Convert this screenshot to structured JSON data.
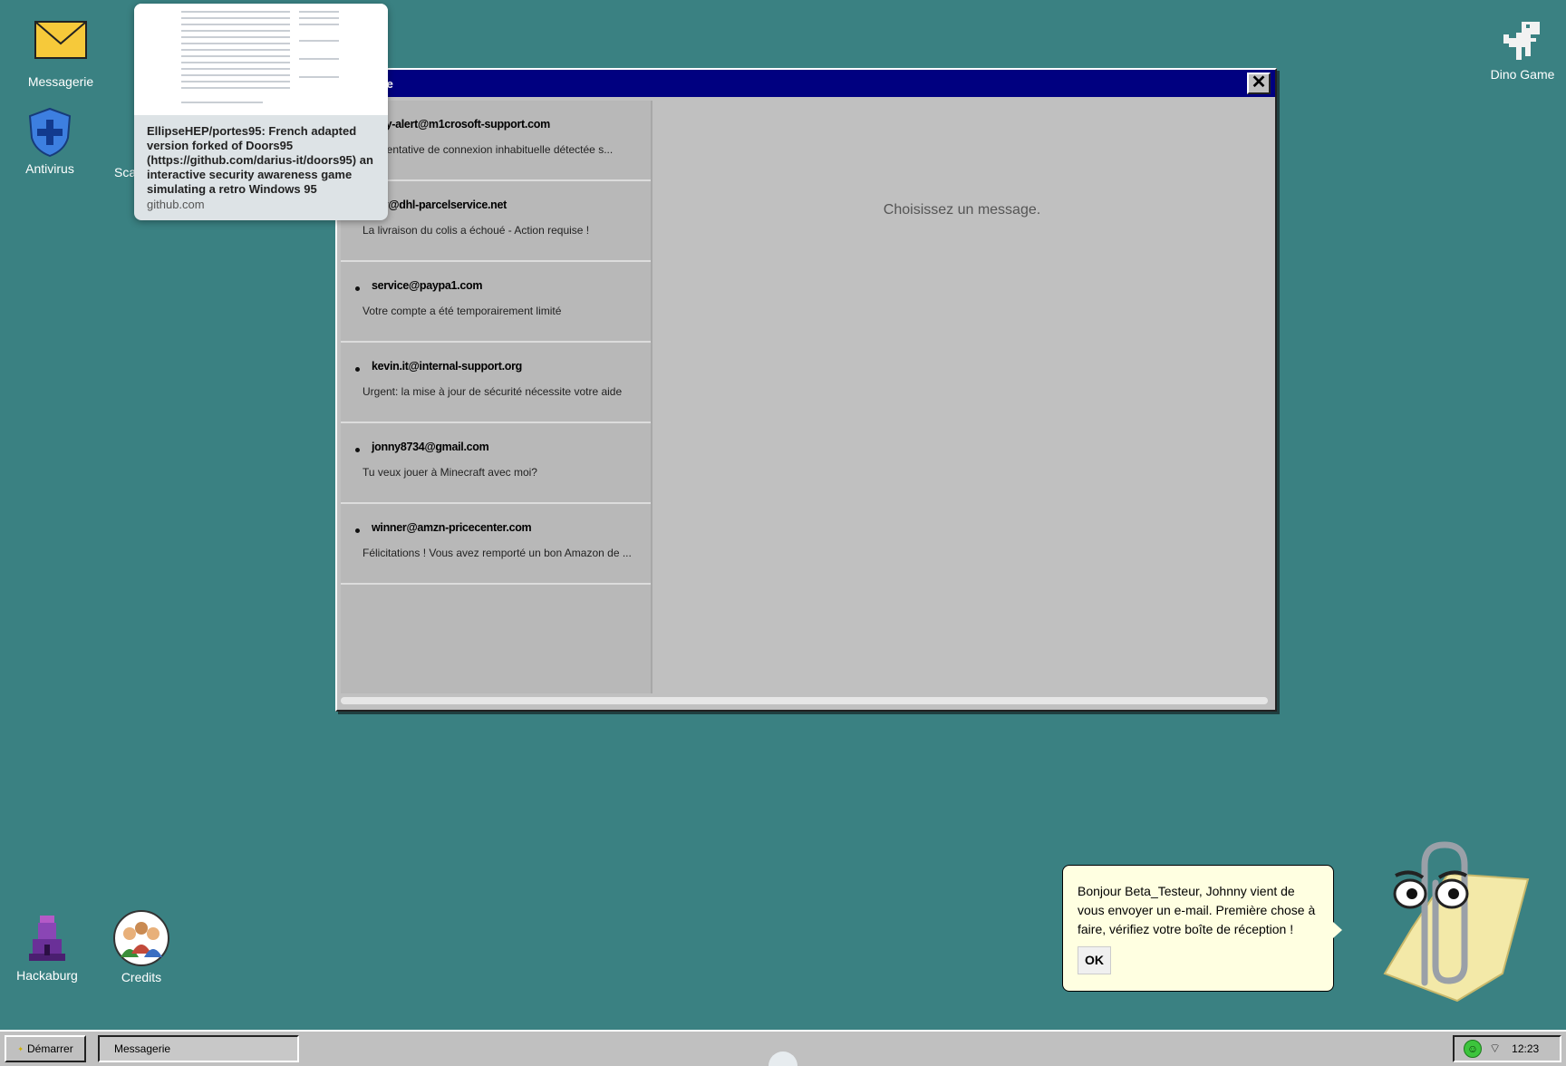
{
  "desktop": {
    "icons": {
      "messagerie": "Messagerie",
      "antivirus": "Antivirus",
      "scanner": "Sca",
      "hackaburg": "Hackaburg",
      "credits": "Credits",
      "dino": "Dino Game"
    }
  },
  "window": {
    "title": "rie",
    "close_glyph": "✕",
    "placeholder": "Choisissez un message.",
    "messages": [
      {
        "from": "curity-alert@m1crosoft-support.com",
        "subject": "ent: tentative de connexion inhabituelle détectée s...",
        "unread": false
      },
      {
        "from": "reply@dhl-parcelservice.net",
        "subject": "La livraison du colis a échoué - Action requise !",
        "unread": false
      },
      {
        "from": "service@paypa1.com",
        "subject": "Votre compte a été temporairement limité",
        "unread": true
      },
      {
        "from": "kevin.it@internal-support.org",
        "subject": "Urgent: la mise à jour de sécurité nécessite votre aide",
        "unread": true
      },
      {
        "from": "jonny8734@gmail.com",
        "subject": "Tu veux jouer à Minecraft avec moi?",
        "unread": true
      },
      {
        "from": "winner@amzn-pricecenter.com",
        "subject": "Félicitations ! Vous avez remporté un bon Amazon de ...",
        "unread": true
      }
    ]
  },
  "link_preview": {
    "description": "EllipseHEP/portes95: French adapted version forked of Doors95 (https://github.com/darius-it/doors95) an interactive security awareness game simulating a retro Windows 95",
    "domain": "github.com"
  },
  "assistant": {
    "message": "Bonjour Beta_Testeur, Johnny vient de vous envoyer un e-mail. Première chose à faire, vérifiez votre boîte de réception !",
    "ok_label": "OK"
  },
  "taskbar": {
    "start_label": "Démarrer",
    "task_label": "Messagerie",
    "clock": "12:23"
  },
  "colors": {
    "desktop": "#3a8182",
    "titlebar": "#000080",
    "window": "#c0c0c0",
    "bubble": "#ffffe1"
  }
}
